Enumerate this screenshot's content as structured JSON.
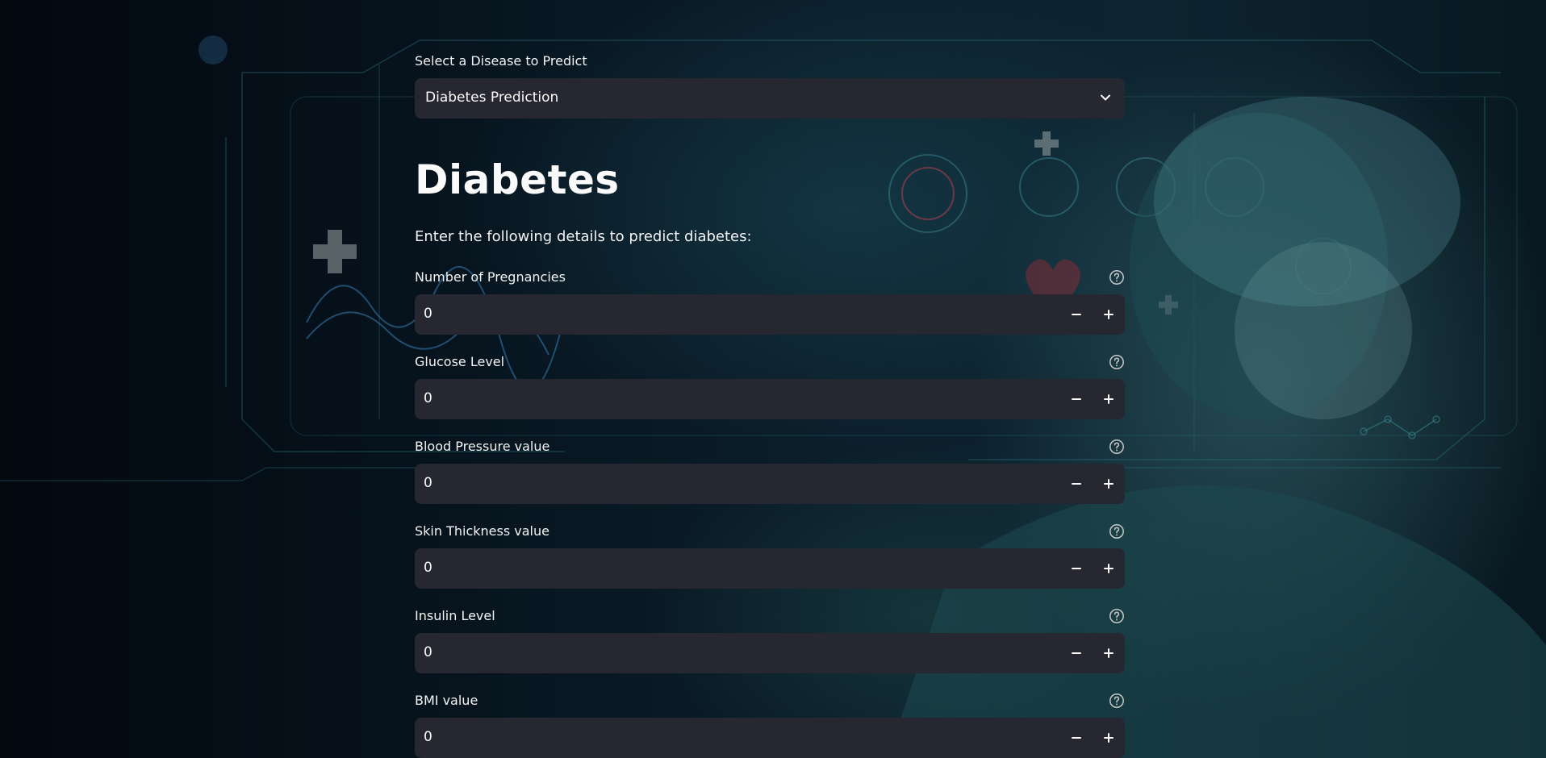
{
  "select": {
    "label": "Select a Disease to Predict",
    "value": "Diabetes Prediction"
  },
  "page": {
    "title": "Diabetes",
    "subtitle": "Enter the following details to predict diabetes:"
  },
  "fields": [
    {
      "label": "Number of Pregnancies",
      "value": "0"
    },
    {
      "label": "Glucose Level",
      "value": "0"
    },
    {
      "label": "Blood Pressure value",
      "value": "0"
    },
    {
      "label": "Skin Thickness value",
      "value": "0"
    },
    {
      "label": "Insulin Level",
      "value": "0"
    },
    {
      "label": "BMI value",
      "value": "0"
    }
  ],
  "icons": {
    "dropdown": "chevron-down-icon",
    "help": "help-circle-icon",
    "decrement": "minus-icon",
    "increment": "plus-icon"
  },
  "colors": {
    "input_background": "#262730",
    "text": "#fafafa",
    "page_background": "#050c14",
    "accent_teal": "#2fa7b0"
  }
}
